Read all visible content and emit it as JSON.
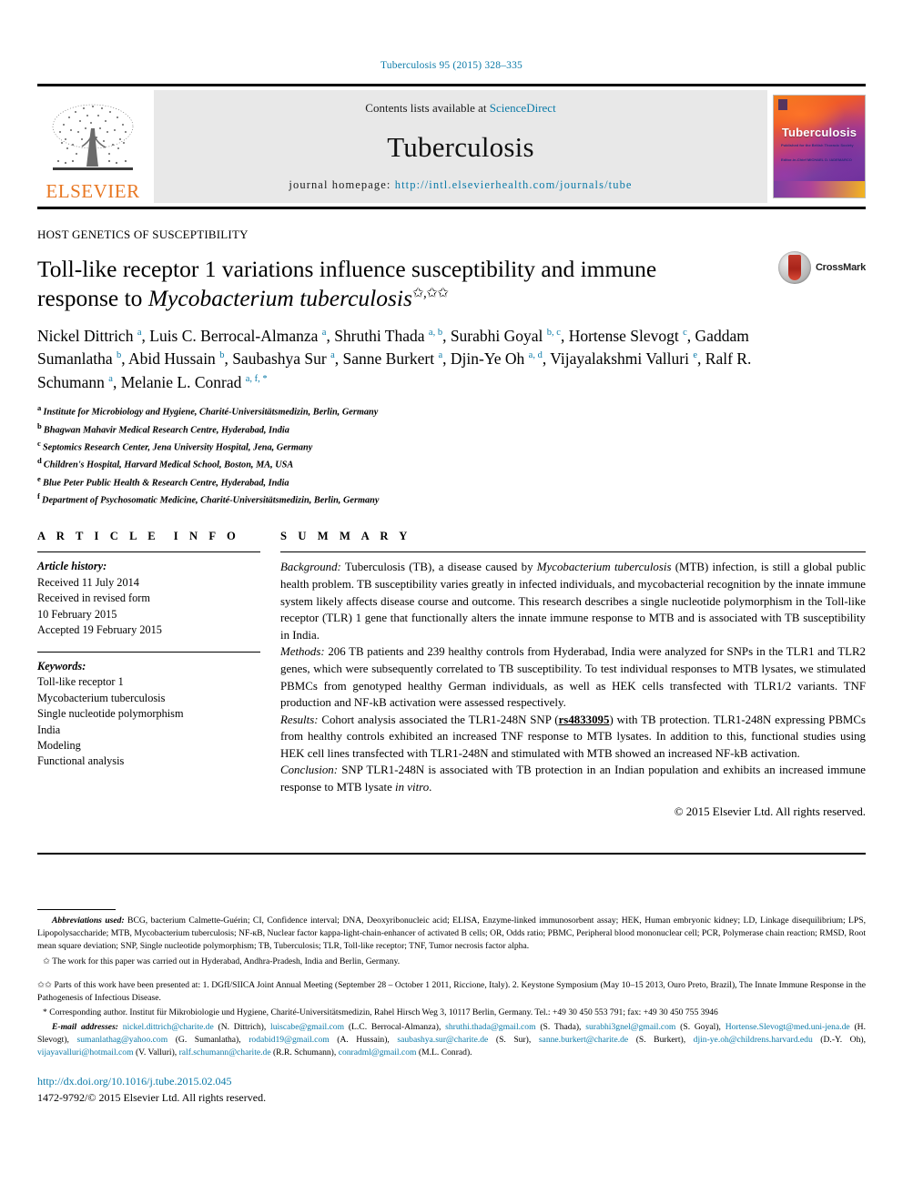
{
  "running_head": "Tuberculosis 95 (2015) 328–335",
  "masthead": {
    "contents_prefix": "Contents lists available at ",
    "sciencedirect": "ScienceDirect",
    "journal_name": "Tuberculosis",
    "homepage_prefix": "journal homepage: ",
    "homepage_url": "http://intl.elsevierhealth.com/journals/tube",
    "publisher": "ELSEVIER",
    "cover_title": "Tuberculosis",
    "cover_sub1": "Published for the\nBritish Thoracic\nSociety",
    "cover_sub2": "Editor-in-Chief\nMICHAEL D. IADEMARCO"
  },
  "article": {
    "kicker": "HOST GENETICS OF SUSCEPTIBILITY",
    "title_part1": "Toll-like receptor 1 variations influence susceptibility and immune response to ",
    "title_italic": "Mycobacterium tuberculosis",
    "title_stars": "✩,✩✩",
    "crossmark_label": "CrossMark",
    "authors": [
      {
        "name": "Nickel Dittrich",
        "sup": "a"
      },
      {
        "name": "Luis C. Berrocal-Almanza",
        "sup": "a"
      },
      {
        "name": "Shruthi Thada",
        "sup": "a, b"
      },
      {
        "name": "Surabhi Goyal",
        "sup": "b, c"
      },
      {
        "name": "Hortense Slevogt",
        "sup": "c"
      },
      {
        "name": "Gaddam Sumanlatha",
        "sup": "b"
      },
      {
        "name": "Abid Hussain",
        "sup": "b"
      },
      {
        "name": "Saubashya Sur",
        "sup": "a"
      },
      {
        "name": "Sanne Burkert",
        "sup": "a"
      },
      {
        "name": "Djin-Ye Oh",
        "sup": "a, d"
      },
      {
        "name": "Vijayalakshmi Valluri",
        "sup": "e"
      },
      {
        "name": "Ralf R. Schumann",
        "sup": "a"
      },
      {
        "name": "Melanie L. Conrad",
        "sup": "a, f, *"
      }
    ],
    "affiliations": [
      {
        "key": "a",
        "text": "Institute for Microbiology and Hygiene, Charité-Universitätsmedizin, Berlin, Germany"
      },
      {
        "key": "b",
        "text": "Bhagwan Mahavir Medical Research Centre, Hyderabad, India"
      },
      {
        "key": "c",
        "text": "Septomics Research Center, Jena University Hospital, Jena, Germany"
      },
      {
        "key": "d",
        "text": "Children's Hospital, Harvard Medical School, Boston, MA, USA"
      },
      {
        "key": "e",
        "text": "Blue Peter Public Health & Research Centre, Hyderabad, India"
      },
      {
        "key": "f",
        "text": "Department of Psychosomatic Medicine, Charité-Universitätsmedizin, Berlin, Germany"
      }
    ]
  },
  "article_info": {
    "heading": "ARTICLE INFO",
    "history_label": "Article history:",
    "history_lines": [
      "Received 11 July 2014",
      "Received in revised form",
      "10 February 2015",
      "Accepted 19 February 2015"
    ],
    "keywords_label": "Keywords:",
    "keywords": [
      "Toll-like receptor 1",
      "Mycobacterium tuberculosis",
      "Single nucleotide polymorphism",
      "India",
      "Modeling",
      "Functional analysis"
    ]
  },
  "summary": {
    "heading": "SUMMARY",
    "background_label": "Background:",
    "background_text_a": " Tuberculosis (TB), a disease caused by ",
    "background_italic": "Mycobacterium tuberculosis",
    "background_text_b": " (MTB) infection, is still a global public health problem. TB susceptibility varies greatly in infected individuals, and mycobacterial recognition by the innate immune system likely affects disease course and outcome. This research describes a single nucleotide polymorphism in the Toll-like receptor (TLR) 1 gene that functionally alters the innate immune response to MTB and is associated with TB susceptibility in India.",
    "methods_label": "Methods:",
    "methods_text": " 206 TB patients and 239 healthy controls from Hyderabad, India were analyzed for SNPs in the TLR1 and TLR2 genes, which were subsequently correlated to TB susceptibility. To test individual responses to MTB lysates, we stimulated PBMCs from genotyped healthy German individuals, as well as HEK cells transfected with TLR1/2 variants. TNF production and NF-kB activation were assessed respectively.",
    "results_label": "Results:",
    "results_text_a": " Cohort analysis associated the TLR1-248N SNP (",
    "results_snp": "rs4833095",
    "results_text_b": ") with TB protection. TLR1-248N expressing PBMCs from healthy controls exhibited an increased TNF response to MTB lysates. In addition to this, functional studies using HEK cell lines transfected with TLR1-248N and stimulated with MTB showed an increased NF-kB activation.",
    "conclusion_label": "Conclusion:",
    "conclusion_text_a": " SNP TLR1-248N is associated with TB protection in an Indian population and exhibits an increased immune response to MTB lysate ",
    "conclusion_italic": "in vitro",
    "conclusion_text_b": ".",
    "copyright": "© 2015 Elsevier Ltd. All rights reserved."
  },
  "footnotes": {
    "abbrev_label": "Abbreviations used:",
    "abbrev_text": " BCG, bacterium Calmette-Guérin; CI, Confidence interval; DNA, Deoxyribonucleic acid; ELISA, Enzyme-linked immunosorbent assay; HEK, Human embryonic kidney; LD, Linkage disequilibrium; LPS, Lipopolysaccharide; MTB, Mycobacterium tuberculosis; NF-кB, Nuclear factor kappa-light-chain-enhancer of activated B cells; OR, Odds ratio; PBMC, Peripheral blood mononuclear cell; PCR, Polymerase chain reaction; RMSD, Root mean square deviation; SNP, Single nucleotide polymorphism; TB, Tuberculosis; TLR, Toll-like receptor; TNF, Tumor necrosis factor alpha.",
    "star_marker": "✩",
    "star_text": " The work for this paper was carried out in Hyderabad, Andhra-Pradesh, India and Berlin, Germany.",
    "dstar_marker": "✩✩",
    "dstar_text": " Parts of this work have been presented at: 1. DGfI/SIICA Joint Annual Meeting (September 28 – October 1 2011, Riccione, Italy). 2. Keystone Symposium (May 10–15 2013, Ouro Preto, Brazil), The Innate Immune Response in the Pathogenesis of Infectious Disease.",
    "corr_marker": "*",
    "corr_text": " Corresponding author. Institut für Mikrobiologie und Hygiene, Charité-Universitätsmedizin, Rahel Hirsch Weg 3, 10117 Berlin, Germany. Tel.: +49 30 450 553 791; fax: +49 30 450 755 3946",
    "email_label": "E-mail addresses:",
    "emails": [
      {
        "addr": "nickel.dittrich@charite.de",
        "who": "(N. Dittrich)"
      },
      {
        "addr": "luiscabe@gmail.com",
        "who": "(L.C. Berrocal-Almanza)"
      },
      {
        "addr": "shruthi.thada@gmail.com",
        "who": "(S. Thada)"
      },
      {
        "addr": "surabhi3gnel@gmail.com",
        "who": "(S. Goyal)"
      },
      {
        "addr": "Hortense.Slevogt@med.uni-jena.de",
        "who": "(H. Slevogt)"
      },
      {
        "addr": "sumanlathag@yahoo.com",
        "who": "(G. Sumanlatha)"
      },
      {
        "addr": "rodabid19@gmail.com",
        "who": "(A. Hussain)"
      },
      {
        "addr": "saubashya.sur@charite.de",
        "who": "(S. Sur)"
      },
      {
        "addr": "sanne.burkert@charite.de",
        "who": "(S. Burkert)"
      },
      {
        "addr": "djin-ye.oh@childrens.harvard.edu",
        "who": "(D.-Y. Oh)"
      },
      {
        "addr": "vijayavalluri@hotmail.com",
        "who": "(V. Valluri)"
      },
      {
        "addr": "ralf.schumann@charite.de",
        "who": "(R.R. Schumann)"
      },
      {
        "addr": "conradml@gmail.com",
        "who": "(M.L. Conrad)"
      }
    ]
  },
  "footer": {
    "doi": "http://dx.doi.org/10.1016/j.tube.2015.02.045",
    "issn_line": "1472-9792/© 2015 Elsevier Ltd. All rights reserved."
  },
  "colors": {
    "link": "#0b7aa8",
    "elsevier_orange": "#E87722",
    "crossmark_red": "#b5231a"
  }
}
